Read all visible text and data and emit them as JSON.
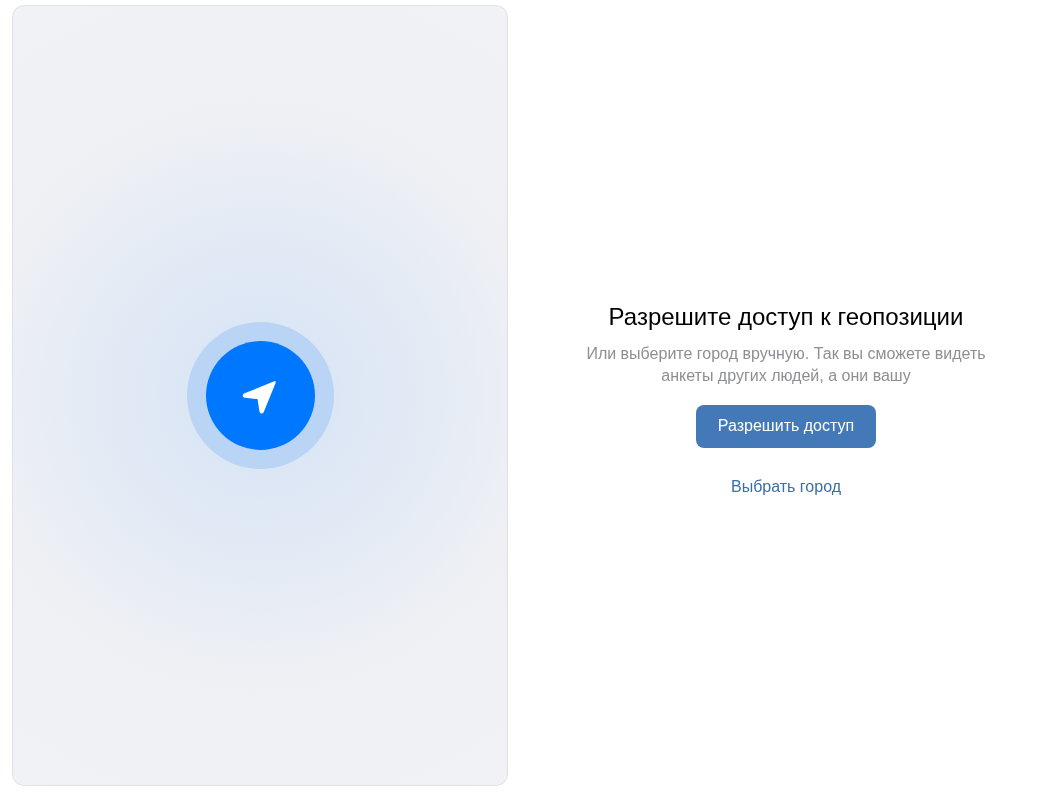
{
  "prompt": {
    "title": "Разрешите доступ к геопозиции",
    "description": "Или выберите город вручную. Так вы сможете видеть анкеты других людей, а они вашу",
    "primary_button": "Разрешить доступ",
    "link": "Выбрать город"
  }
}
